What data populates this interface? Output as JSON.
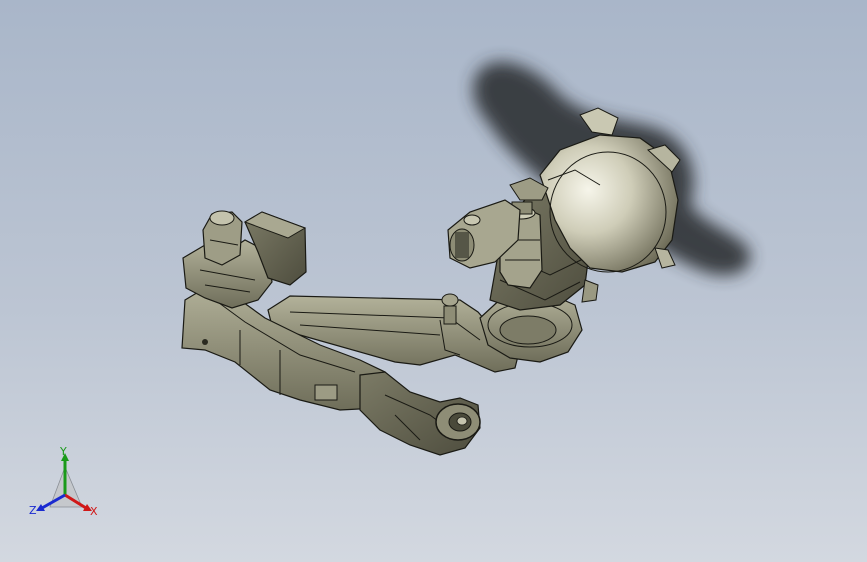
{
  "viewport": {
    "background_top": "#a9b6c9",
    "background_bottom": "#d3d8e0"
  },
  "model": {
    "body_color": "#8e8d76",
    "edge_color": "#1a1a14",
    "shadow_color": "#2e3036",
    "motor_highlight": "#f2f1e4"
  },
  "triad": {
    "x_label": "X",
    "y_label": "Y",
    "z_label": "Z",
    "x_color": "#d01818",
    "y_color": "#1a9a1a",
    "z_color": "#1a2ad0"
  }
}
